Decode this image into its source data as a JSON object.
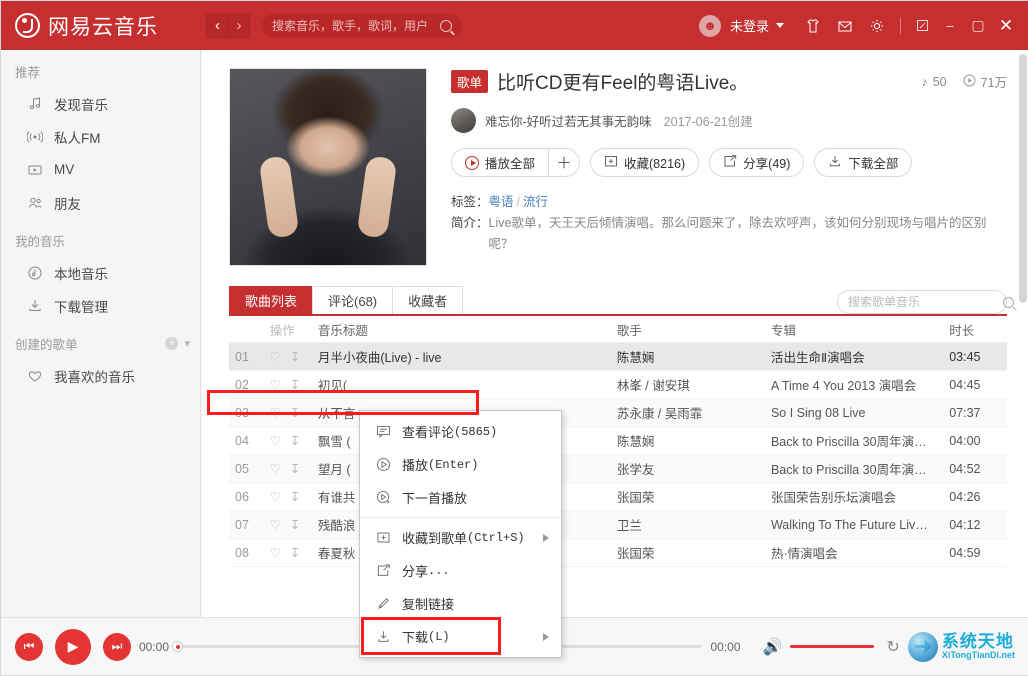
{
  "app": {
    "logo_text": "网易云音乐",
    "search_placeholder": "搜索音乐，歌手，歌词，用户",
    "nav_back": "‹",
    "nav_forward": "›",
    "login_label": "未登录",
    "icons": {
      "avatar": "avatar-icon",
      "tshirt": "tshirt-icon",
      "mail": "mail-icon",
      "gear": "gear-icon",
      "restore": "restore-icon",
      "minimize": "−",
      "maximize": "▢",
      "close": "✕"
    }
  },
  "sidebar": {
    "groups": [
      {
        "label": "推荐",
        "items": [
          {
            "label": "发现音乐",
            "icon": "music-note-icon"
          },
          {
            "label": "私人FM",
            "icon": "radio-fm-icon"
          },
          {
            "label": "MV",
            "icon": "video-play-icon"
          },
          {
            "label": "朋友",
            "icon": "friends-icon"
          }
        ]
      },
      {
        "label": "我的音乐",
        "items": [
          {
            "label": "本地音乐",
            "icon": "local-music-icon"
          },
          {
            "label": "下载管理",
            "icon": "download-icon"
          }
        ]
      },
      {
        "label": "创建的歌单",
        "has_tools": true,
        "items": [
          {
            "label": "我喜欢的音乐",
            "icon": "heart-icon"
          }
        ]
      }
    ]
  },
  "playlist": {
    "badge": "歌单",
    "title": "比听CD更有Feel的粤语Live。",
    "song_count": "50",
    "play_count": "71万",
    "author": "难忘你-好听过若无其事无韵味",
    "created_date": "2017-06-21创建",
    "actions": {
      "play_all": "播放全部",
      "plus": "＋",
      "favorite": "收藏(8216)",
      "share": "分享(49)",
      "download_all": "下载全部"
    },
    "tags_key": "标签：",
    "tags": [
      "粤语",
      "流行"
    ],
    "tag_sep": "/",
    "desc_key": "简介：",
    "desc_value": "Live歌单，天王天后倾情演唱。那么问题来了，除去欢呼声，该如何分别现场与唱片的区别呢？"
  },
  "tabs": {
    "items": [
      {
        "label": "歌曲列表",
        "active": true
      },
      {
        "label": "评论(68)",
        "active": false
      },
      {
        "label": "收藏者",
        "active": false
      }
    ],
    "search_placeholder": "搜索歌单音乐"
  },
  "table": {
    "columns": [
      "",
      "操作",
      "音乐标题",
      "歌手",
      "专辑",
      "时长"
    ],
    "rows": [
      {
        "idx": "01",
        "title": "月半小夜曲(Live) - live",
        "artist": "陈慧娴",
        "album": "活出生命Ⅱ演唱会",
        "duration": "03:45",
        "selected": true
      },
      {
        "idx": "02",
        "title": "初见(",
        "artist": "林峯 / 谢安琪",
        "album": "A Time 4 You 2013 演唱会",
        "duration": "04:45"
      },
      {
        "idx": "03",
        "title": "从不言",
        "artist": "苏永康 / 吴雨霏",
        "album": "So I Sing 08 Live",
        "duration": "07:37"
      },
      {
        "idx": "04",
        "title": "飘雪 (",
        "artist": "陈慧娴",
        "album": "Back to Priscilla 30周年演…",
        "duration": "04:00"
      },
      {
        "idx": "05",
        "title": "望月 (",
        "artist": "张学友",
        "album": "Back to Priscilla 30周年演…",
        "duration": "04:52"
      },
      {
        "idx": "06",
        "title": "有谁共",
        "artist": "张国荣",
        "album": "张国荣告别乐坛演唱会",
        "duration": "04:26"
      },
      {
        "idx": "07",
        "title": "残酷浪",
        "artist": "卫兰",
        "album": "Walking To The Future Liv…",
        "duration": "04:12"
      },
      {
        "idx": "08",
        "title": "春夏秋",
        "artist": "张国荣",
        "album": "热·情演唱会",
        "duration": "04:59"
      }
    ]
  },
  "context_menu": {
    "items": [
      {
        "label": "查看评论",
        "suffix": "(5865)",
        "icon": "comment-icon",
        "submenu": false
      },
      {
        "label": "播放",
        "suffix": "(Enter)",
        "icon": "play-circle-icon",
        "submenu": false
      },
      {
        "label": "下一首播放",
        "suffix": "",
        "icon": "play-next-icon",
        "submenu": false
      },
      {
        "label": "收藏到歌单",
        "suffix": "(Ctrl+S)",
        "icon": "add-box-icon",
        "submenu": true
      },
      {
        "label": "分享",
        "suffix": "...",
        "icon": "share-icon",
        "submenu": false
      },
      {
        "label": "复制链接",
        "suffix": "",
        "icon": "link-icon",
        "submenu": false
      },
      {
        "label": "下载",
        "suffix": "(L)",
        "icon": "download-icon",
        "submenu": true,
        "highlighted": true
      }
    ]
  },
  "player": {
    "current_time": "00:00",
    "total_time": "00:00",
    "prev_icon": "skip-previous-icon",
    "play_icon": "play-icon",
    "next_icon": "skip-next-icon",
    "volume_icon": "volume-icon",
    "loop_icon": "loop-icon"
  },
  "watermark": {
    "cn": "系统天地",
    "en": "XiTongTianDi.net"
  },
  "colors": {
    "brand_red": "#c62f2f",
    "player_red": "#e53434",
    "annotation_red": "#fb1d1d",
    "tag_link": "#4a7ebb",
    "watermark_blue": "#1eacd8"
  }
}
